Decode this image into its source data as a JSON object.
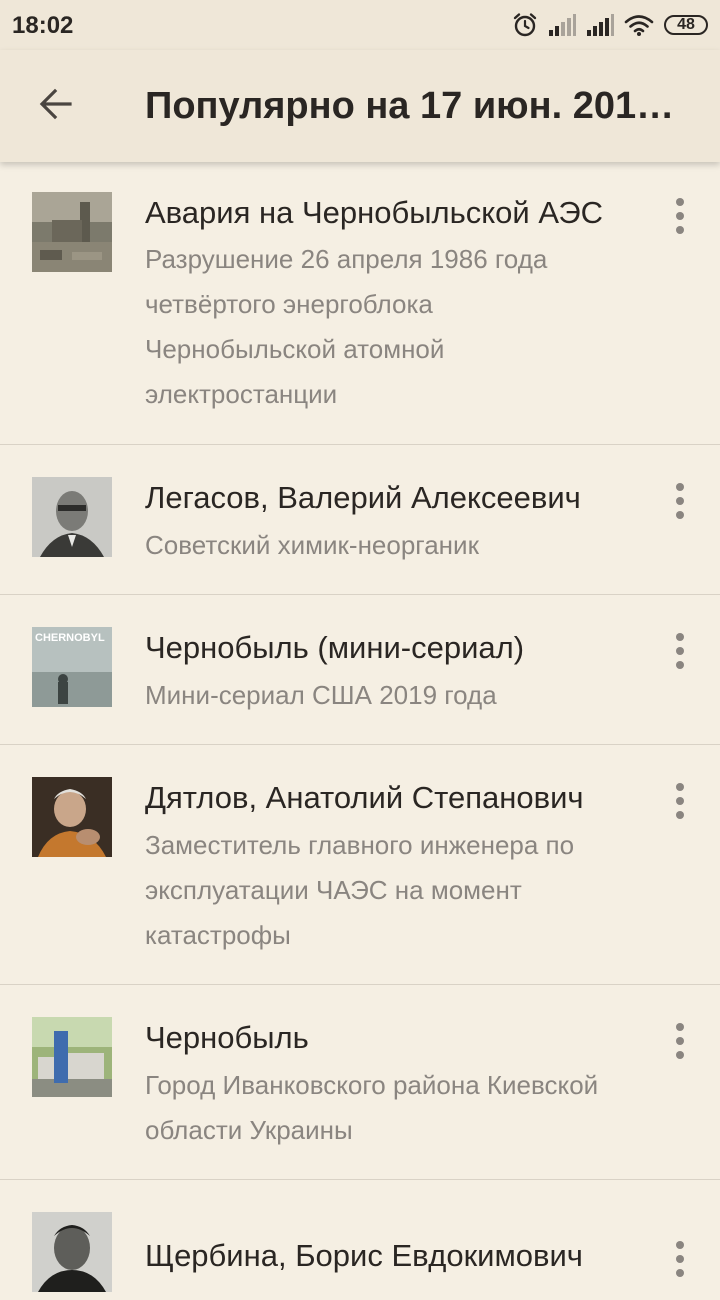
{
  "status_bar": {
    "time": "18:02",
    "battery": "48",
    "icons": [
      "alarm-icon",
      "signal-icon",
      "signal-icon",
      "wifi-icon",
      "battery-icon"
    ]
  },
  "app_bar": {
    "title": "Популярно на 17 июн. 201…",
    "back_icon": "arrow-back-icon"
  },
  "items": [
    {
      "title": "Авария на Чернобыльской АЭС",
      "description": "Разрушение 26 апреля 1986 года четвёртого энергоблока Чернобыльской атомной электростанции",
      "thumbnail": "ruined-reactor-photo"
    },
    {
      "title": "Легасов, Валерий Алексеевич",
      "description": "Советский химик-неорганик",
      "thumbnail": "portrait-photo"
    },
    {
      "title": "Чернобыль (мини-сериал)",
      "description": "Мини-сериал США 2019 года",
      "thumbnail": "series-poster",
      "thumbnail_text": "CHERNOBYL"
    },
    {
      "title": "Дятлов, Анатолий Степанович",
      "description": "Заместитель главного инженера по эксплуатации ЧАЭС на момент катастрофы",
      "thumbnail": "portrait-photo"
    },
    {
      "title": "Чернобыль",
      "description": "Город Иванковского района Киевской области Украины",
      "thumbnail": "city-sign-photo"
    },
    {
      "title": "Щербина, Борис Евдокимович",
      "description": "",
      "thumbnail": "portrait-photo"
    }
  ],
  "colors": {
    "background": "#f5efe3",
    "app_bar": "#efe7d8",
    "title_text": "#2a2623",
    "secondary_text": "#8a8580",
    "divider": "#d9d2c6"
  }
}
